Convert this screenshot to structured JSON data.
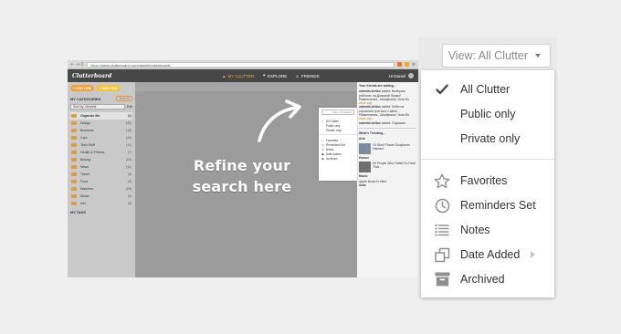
{
  "browser": {
    "nav_glyphs": "← → C",
    "url_secure": "https://",
    "url_rest": "www.clutterboard.com/danielle/dashboard/",
    "app_logo": "Clutterboard",
    "menu": [
      "MY CLUTTER",
      "EXPLORE",
      "FRIENDS"
    ],
    "user_name": "Hi Daniel",
    "add_link_label": "+ ADD LINK",
    "add_file_label": "+ ADD FILE",
    "categories_title": "MY CATEGORIES",
    "view_all_label": "View All",
    "sort_label": "Sort by: Newest",
    "edit_label": "Edit",
    "categories": [
      {
        "name": "Organize Me",
        "count": "(0)"
      },
      {
        "name": "Design",
        "count": "(26)"
      },
      {
        "name": "Business",
        "count": "(18)"
      },
      {
        "name": "Cars",
        "count": "(40)"
      },
      {
        "name": "Tech Stuff",
        "count": "(14)"
      },
      {
        "name": "Health & Fitness",
        "count": "(7)"
      },
      {
        "name": "Boxing",
        "count": "(20)"
      },
      {
        "name": "News",
        "count": "(11)"
      },
      {
        "name": "Travel",
        "count": "(5)"
      },
      {
        "name": "Food",
        "count": "(0)"
      },
      {
        "name": "Watches",
        "count": "(26)"
      },
      {
        "name": "Music",
        "count": "(9)"
      },
      {
        "name": "Info",
        "count": "(3)"
      }
    ],
    "tags_title": "MY TAGS",
    "right_panel": {
      "friends_heading": "Your friends are adding...",
      "feed_1_user": "valentin.kirilov",
      "feed_1_text": "added: Выйграть работать на Домовой Прямо! Развлечения - Шкафчики | Vosk.Ru",
      "feed_1_time": "week ago",
      "feed_2_user": "valentin.kirilov",
      "feed_2_text": "added: Seifin na строителя третьего Сайта! - Развлечения - Шкафчики | Vosk.Ru",
      "feed_2_time": "week ago",
      "feed_3_user": "valentin.kirilov",
      "feed_3_text": "added: Отдыхать",
      "trending_heading": "What's Trending...",
      "trend_1_category": "Arts",
      "trend_1_title": "15 Giant Flower Sculptures Hanked",
      "trend_2_category": "Humor",
      "trend_2_title": "25 People Who Failed So Hard That...",
      "trend_3_category": "Music",
      "trend_3_title": "Apple Music Is Here",
      "trend_4_category": "Auto"
    },
    "mini_menu": {
      "button": "View: All Clutter",
      "items": [
        "All Clutter",
        "Public only",
        "Private only",
        "Favorites",
        "Reminders Set",
        "Notes",
        "Date Added",
        "Archived"
      ]
    }
  },
  "callout": {
    "line1": "Refine your",
    "line2": "search here"
  },
  "dropdown": {
    "button_label": "View: All Clutter",
    "visibility_options": [
      {
        "label": "All Clutter",
        "icon": "checkmark-icon",
        "selected": true
      },
      {
        "label": "Public only",
        "icon": "",
        "selected": false
      },
      {
        "label": "Private only",
        "icon": "",
        "selected": false
      }
    ],
    "filter_options": [
      {
        "label": "Favorites",
        "icon": "star-icon"
      },
      {
        "label": "Reminders Set",
        "icon": "clock-icon"
      },
      {
        "label": "Notes",
        "icon": "notes-icon"
      },
      {
        "label": "Date Added",
        "icon": "date-added-icon",
        "has_submenu": true
      },
      {
        "label": "Archived",
        "icon": "archive-icon"
      }
    ]
  },
  "colors": {
    "page_background": "#efefef",
    "accent_orange": "#f0a13c",
    "menu_text": "#333333",
    "button_text": "#8a8a8a",
    "icon_gray": "#8f8f8f"
  }
}
